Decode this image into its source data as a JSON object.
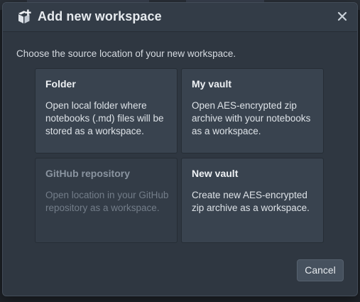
{
  "dialog": {
    "title": "Add new workspace",
    "prompt": "Choose the source location of your new workspace.",
    "header_icon": "box-plus-icon",
    "close_icon": "close-icon"
  },
  "options": [
    {
      "id": "folder",
      "title": "Folder",
      "description": "Open local folder where notebooks (.md) files will be stored as a workspace.",
      "enabled": true
    },
    {
      "id": "my-vault",
      "title": "My vault",
      "description": "Open AES-encrypted zip archive with your notebooks as a workspace.",
      "enabled": true
    },
    {
      "id": "github-repository",
      "title": "GitHub repository",
      "description": "Open location in your GitHub repository as a workspace.",
      "enabled": false
    },
    {
      "id": "new-vault",
      "title": "New vault",
      "description": "Create new AES-encrypted zip archive as a workspace.",
      "enabled": true
    }
  ],
  "footer": {
    "cancel_label": "Cancel"
  },
  "colors": {
    "dialog_bg": "#2f3741",
    "card_bg": "#39434f",
    "disabled_text": "#737d89",
    "title_text": "#e6eaee"
  }
}
